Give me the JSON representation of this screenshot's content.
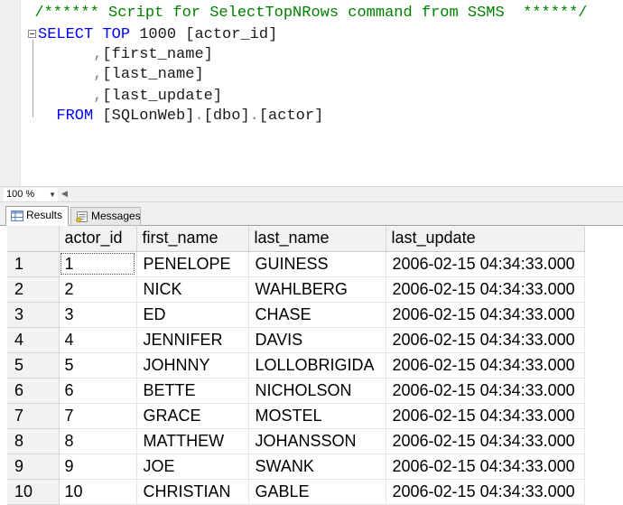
{
  "editor": {
    "zoom_level": "100 %",
    "lines": [
      {
        "tokens": [
          {
            "t": "  /****** Script for SelectTopNRows command from SSMS  ******/",
            "k": "cm"
          }
        ]
      },
      {
        "tokens": [
          {
            "t": "SELECT",
            "k": "kw"
          },
          {
            "t": " ",
            "k": "tx"
          },
          {
            "t": "TOP",
            "k": "kw"
          },
          {
            "t": " 1000 ",
            "k": "tx"
          },
          {
            "t": "[actor_id]",
            "k": "tx"
          }
        ]
      },
      {
        "tokens": [
          {
            "t": "      ",
            "k": "tx"
          },
          {
            "t": ",",
            "k": "op"
          },
          {
            "t": "[first_name]",
            "k": "tx"
          }
        ]
      },
      {
        "tokens": [
          {
            "t": "      ",
            "k": "tx"
          },
          {
            "t": ",",
            "k": "op"
          },
          {
            "t": "[last_name]",
            "k": "tx"
          }
        ]
      },
      {
        "tokens": [
          {
            "t": "      ",
            "k": "tx"
          },
          {
            "t": ",",
            "k": "op"
          },
          {
            "t": "[last_update]",
            "k": "tx"
          }
        ]
      },
      {
        "tokens": [
          {
            "t": "  ",
            "k": "tx"
          },
          {
            "t": "FROM",
            "k": "kw"
          },
          {
            "t": " [SQLonWeb]",
            "k": "tx"
          },
          {
            "t": ".",
            "k": "op"
          },
          {
            "t": "[dbo]",
            "k": "tx"
          },
          {
            "t": ".",
            "k": "op"
          },
          {
            "t": "[actor]",
            "k": "tx"
          }
        ]
      }
    ]
  },
  "tabs": {
    "results_label": "Results",
    "messages_label": "Messages"
  },
  "grid": {
    "columns": [
      "actor_id",
      "first_name",
      "last_name",
      "last_update"
    ],
    "rows": [
      {
        "n": "1",
        "actor_id": "1",
        "first_name": "PENELOPE",
        "last_name": "GUINESS",
        "last_update": "2006-02-15 04:34:33.000"
      },
      {
        "n": "2",
        "actor_id": "2",
        "first_name": "NICK",
        "last_name": "WAHLBERG",
        "last_update": "2006-02-15 04:34:33.000"
      },
      {
        "n": "3",
        "actor_id": "3",
        "first_name": "ED",
        "last_name": "CHASE",
        "last_update": "2006-02-15 04:34:33.000"
      },
      {
        "n": "4",
        "actor_id": "4",
        "first_name": "JENNIFER",
        "last_name": "DAVIS",
        "last_update": "2006-02-15 04:34:33.000"
      },
      {
        "n": "5",
        "actor_id": "5",
        "first_name": "JOHNNY",
        "last_name": "LOLLOBRIGIDA",
        "last_update": "2006-02-15 04:34:33.000"
      },
      {
        "n": "6",
        "actor_id": "6",
        "first_name": "BETTE",
        "last_name": "NICHOLSON",
        "last_update": "2006-02-15 04:34:33.000"
      },
      {
        "n": "7",
        "actor_id": "7",
        "first_name": "GRACE",
        "last_name": "MOSTEL",
        "last_update": "2006-02-15 04:34:33.000"
      },
      {
        "n": "8",
        "actor_id": "8",
        "first_name": "MATTHEW",
        "last_name": "JOHANSSON",
        "last_update": "2006-02-15 04:34:33.000"
      },
      {
        "n": "9",
        "actor_id": "9",
        "first_name": "JOE",
        "last_name": "SWANK",
        "last_update": "2006-02-15 04:34:33.000"
      },
      {
        "n": "10",
        "actor_id": "10",
        "first_name": "CHRISTIAN",
        "last_name": "GABLE",
        "last_update": "2006-02-15 04:34:33.000"
      }
    ]
  }
}
